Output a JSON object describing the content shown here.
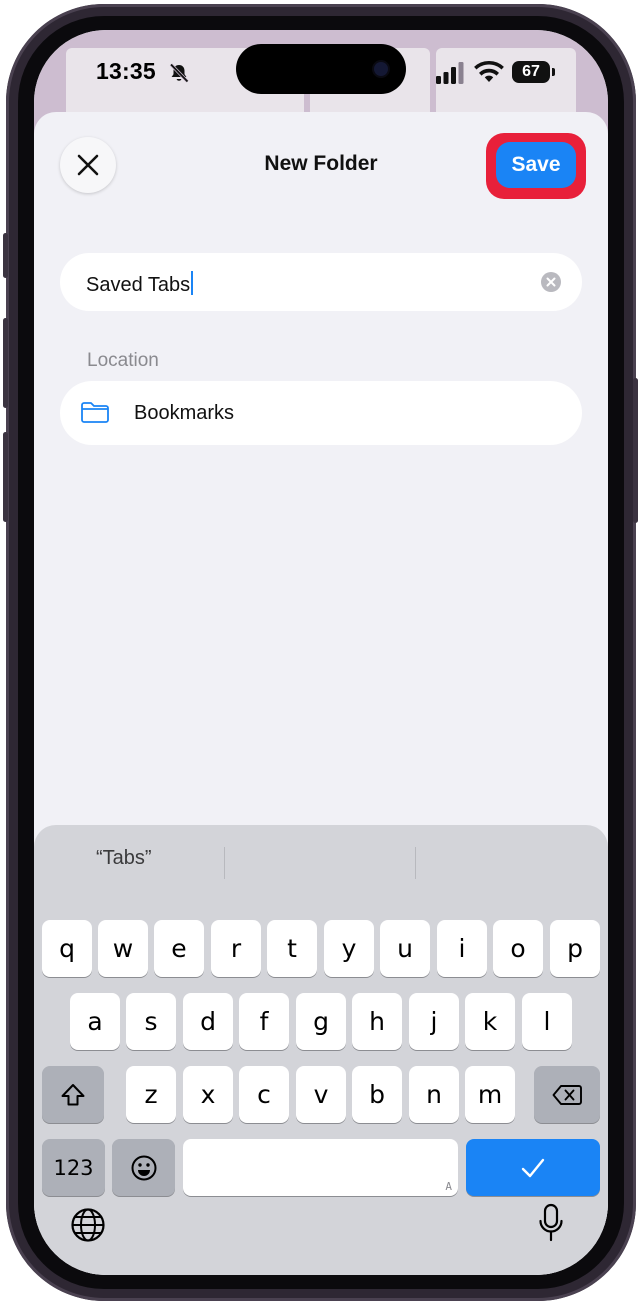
{
  "status_bar": {
    "time": "13:35",
    "battery": "67"
  },
  "sheet": {
    "title": "New Folder",
    "save_label": "Save"
  },
  "form": {
    "name_value": "Saved Tabs",
    "location_label": "Location",
    "location_value": "Bookmarks"
  },
  "keyboard": {
    "suggestion": "“Tabs”",
    "row1": [
      "q",
      "w",
      "e",
      "r",
      "t",
      "y",
      "u",
      "i",
      "o",
      "p"
    ],
    "row2": [
      "a",
      "s",
      "d",
      "f",
      "g",
      "h",
      "j",
      "k",
      "l"
    ],
    "row3": [
      "z",
      "x",
      "c",
      "v",
      "b",
      "n",
      "m"
    ],
    "numbers_label": "123",
    "space_hint": "A"
  },
  "colors": {
    "accent": "#1a84f5",
    "highlight": "#e8203a"
  }
}
